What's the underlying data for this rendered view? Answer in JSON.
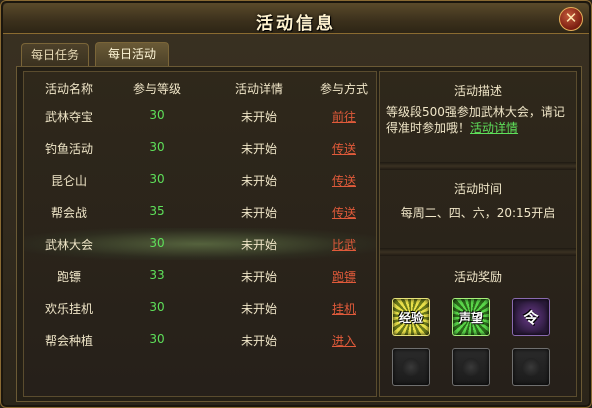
{
  "window": {
    "title": "活动信息",
    "close_label": "✕"
  },
  "tabs": [
    {
      "label": "每日任务",
      "active": false
    },
    {
      "label": "每日活动",
      "active": true
    }
  ],
  "table": {
    "headers": [
      "活动名称",
      "参与等级",
      "活动详情",
      "参与方式"
    ],
    "rows": [
      {
        "name": "武林夺宝",
        "level": "30",
        "status": "未开始",
        "action": "前往"
      },
      {
        "name": "钓鱼活动",
        "level": "30",
        "status": "未开始",
        "action": "传送"
      },
      {
        "name": "昆仑山",
        "level": "30",
        "status": "未开始",
        "action": "传送"
      },
      {
        "name": "帮会战",
        "level": "35",
        "status": "未开始",
        "action": "传送"
      },
      {
        "name": "武林大会",
        "level": "30",
        "status": "未开始",
        "action": "比武"
      },
      {
        "name": "跑镖",
        "level": "33",
        "status": "未开始",
        "action": "跑镖"
      },
      {
        "name": "欢乐挂机",
        "level": "30",
        "status": "未开始",
        "action": "挂机"
      },
      {
        "name": "帮会种植",
        "level": "30",
        "status": "未开始",
        "action": "进入"
      }
    ]
  },
  "side": {
    "desc_title": "活动描述",
    "desc_text": "等级段500强参加武林大会，请记得准时参加哦！",
    "desc_link": "活动详情",
    "time_title": "活动时间",
    "time_text": "每周二、四、六，20:15开启",
    "reward_title": "活动奖励",
    "rewards": [
      {
        "label": "经验",
        "icon": "exp-reward-icon"
      },
      {
        "label": "声望",
        "icon": "fame-reward-icon"
      },
      {
        "label": "令",
        "icon": "token-reward-icon"
      }
    ]
  },
  "colors": {
    "level": "#5ee05a",
    "action": "#e05a3a",
    "text": "#f0e6c8"
  }
}
